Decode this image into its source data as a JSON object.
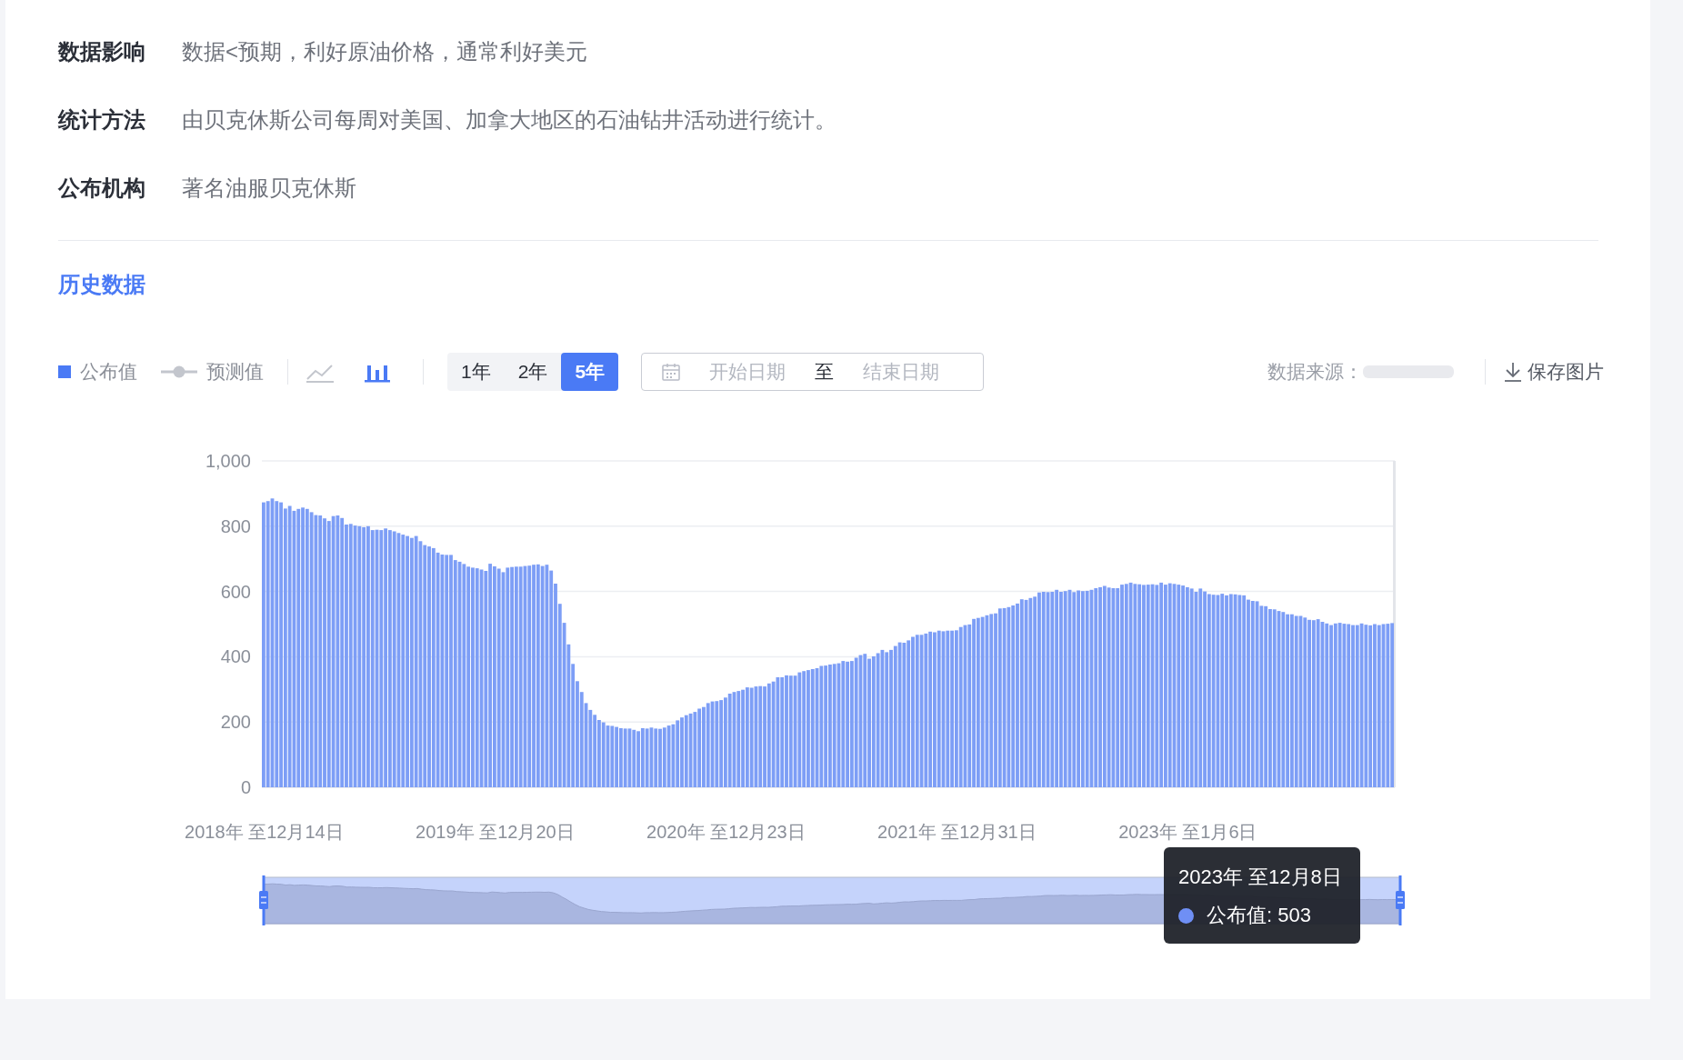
{
  "details": [
    {
      "label": "数据影响",
      "value": "数据<预期，利好原油价格，通常利好美元"
    },
    {
      "label": "统计方法",
      "value": "由贝克休斯公司每周对美国、加拿大地区的石油钻井活动进行统计。"
    },
    {
      "label": "公布机构",
      "value": "著名油服贝克休斯"
    }
  ],
  "section_title": "历史数据",
  "toolbar": {
    "legend": [
      {
        "kind": "bar",
        "label": "公布值"
      },
      {
        "kind": "line",
        "label": "预测值"
      }
    ],
    "chart_types": [
      {
        "kind": "line",
        "selected": false
      },
      {
        "kind": "bar",
        "selected": true
      }
    ],
    "ranges": [
      {
        "label": "1年",
        "selected": false
      },
      {
        "label": "2年",
        "selected": false
      },
      {
        "label": "5年",
        "selected": true
      }
    ],
    "date_range": {
      "start_placeholder": "开始日期",
      "separator": "至",
      "end_placeholder": "结束日期"
    },
    "source_label": "数据来源：",
    "save_button": "保存图片"
  },
  "chart": {
    "chart_data": {
      "type": "bar",
      "ylim": [
        0,
        1000
      ],
      "yticks": [
        0,
        200,
        400,
        600,
        800,
        {
          "value": 1000,
          "label": "1,000"
        }
      ],
      "grid": true,
      "categories": [
        "2018年 至12月14日",
        null,
        null,
        null,
        null,
        null,
        null,
        null,
        null,
        null,
        null,
        null,
        null,
        null,
        null,
        null,
        null,
        null,
        null,
        null,
        null,
        null,
        null,
        null,
        null,
        null,
        null,
        null,
        null,
        null,
        null,
        null,
        null,
        null,
        null,
        null,
        null,
        null,
        null,
        null,
        null,
        null,
        null,
        null,
        null,
        null,
        null,
        null,
        null,
        null,
        null,
        null,
        null,
        "2019年 至12月20日",
        null,
        null,
        null,
        null,
        null,
        null,
        null,
        null,
        null,
        null,
        null,
        null,
        null,
        null,
        null,
        null,
        null,
        null,
        null,
        null,
        null,
        null,
        null,
        null,
        null,
        null,
        null,
        null,
        null,
        null,
        null,
        null,
        null,
        null,
        null,
        null,
        null,
        null,
        null,
        null,
        null,
        null,
        null,
        null,
        null,
        null,
        null,
        null,
        null,
        null,
        null,
        null,
        "2020年 至12月23日",
        null,
        null,
        null,
        null,
        null,
        null,
        null,
        null,
        null,
        null,
        null,
        null,
        null,
        null,
        null,
        null,
        null,
        null,
        null,
        null,
        null,
        null,
        null,
        null,
        null,
        null,
        null,
        null,
        null,
        null,
        null,
        null,
        null,
        null,
        null,
        null,
        null,
        null,
        null,
        null,
        null,
        null,
        null,
        null,
        null,
        null,
        null,
        null,
        null,
        null,
        null,
        null,
        "2021年 至12月31日",
        null,
        null,
        null,
        null,
        null,
        null,
        null,
        null,
        null,
        null,
        null,
        null,
        null,
        null,
        null,
        null,
        null,
        null,
        null,
        null,
        null,
        null,
        null,
        null,
        null,
        null,
        null,
        null,
        null,
        null,
        null,
        null,
        null,
        null,
        null,
        null,
        null,
        null,
        null,
        null,
        null,
        null,
        null,
        null,
        null,
        null,
        null,
        null,
        null,
        null,
        null,
        null,
        "2023年 至1月6日",
        null,
        null,
        null,
        null,
        null,
        null,
        null,
        null,
        null,
        null,
        null,
        null,
        null,
        null,
        null,
        null,
        null,
        null,
        null,
        null,
        null,
        null,
        null,
        null,
        null,
        null,
        null,
        null,
        null,
        null,
        null,
        null,
        null,
        null,
        null,
        null,
        null,
        null,
        null,
        null,
        null,
        null,
        null,
        null,
        null,
        null,
        null
      ],
      "values": [
        873,
        877,
        885,
        877,
        873,
        854,
        862,
        847,
        853,
        857,
        853,
        843,
        834,
        833,
        824,
        816,
        831,
        833,
        825,
        805,
        807,
        802,
        800,
        797,
        800,
        788,
        789,
        788,
        793,
        788,
        784,
        779,
        774,
        770,
        764,
        770,
        754,
        742,
        738,
        733,
        719,
        713,
        712,
        712,
        696,
        691,
        684,
        676,
        673,
        671,
        667,
        663,
        685,
        677,
        670,
        659,
        673,
        675,
        676,
        676,
        678,
        679,
        682,
        683,
        678,
        682,
        664,
        624,
        562,
        504,
        438,
        378,
        325,
        292,
        258,
        237,
        222,
        206,
        199,
        189,
        188,
        185,
        181,
        180,
        180,
        176,
        172,
        181,
        180,
        183,
        180,
        179,
        183,
        189,
        193,
        205,
        214,
        221,
        226,
        231,
        241,
        246,
        258,
        263,
        264,
        267,
        275,
        287,
        292,
        295,
        299,
        306,
        305,
        309,
        310,
        309,
        318,
        324,
        337,
        337,
        343,
        342,
        342,
        352,
        356,
        359,
        362,
        365,
        372,
        373,
        376,
        378,
        380,
        387,
        385,
        387,
        397,
        405,
        409,
        394,
        401,
        411,
        421,
        414,
        421,
        433,
        444,
        443,
        450,
        461,
        467,
        467,
        471,
        477,
        475,
        480,
        478,
        480,
        480,
        481,
        491,
        497,
        499,
        516,
        519,
        522,
        527,
        531,
        533,
        548,
        549,
        552,
        557,
        563,
        576,
        574,
        580,
        584,
        597,
        599,
        598,
        599,
        605,
        599,
        601,
        605,
        598,
        603,
        601,
        602,
        605,
        610,
        613,
        617,
        612,
        610,
        610,
        621,
        623,
        627,
        623,
        622,
        620,
        621,
        622,
        620,
        627,
        621,
        625,
        623,
        621,
        618,
        613,
        609,
        599,
        609,
        600,
        592,
        590,
        589,
        593,
        588,
        592,
        591,
        589,
        588,
        575,
        571,
        570,
        556,
        555,
        546,
        545,
        540,
        537,
        530,
        530,
        525,
        525,
        520,
        513,
        512,
        515,
        507,
        502,
        497,
        502,
        504,
        501,
        500,
        497,
        497,
        502,
        498,
        496,
        500,
        497,
        500,
        501,
        503
      ]
    },
    "tooltip": {
      "title": "2023年 至12月8日",
      "label": "公布值: 503"
    }
  }
}
